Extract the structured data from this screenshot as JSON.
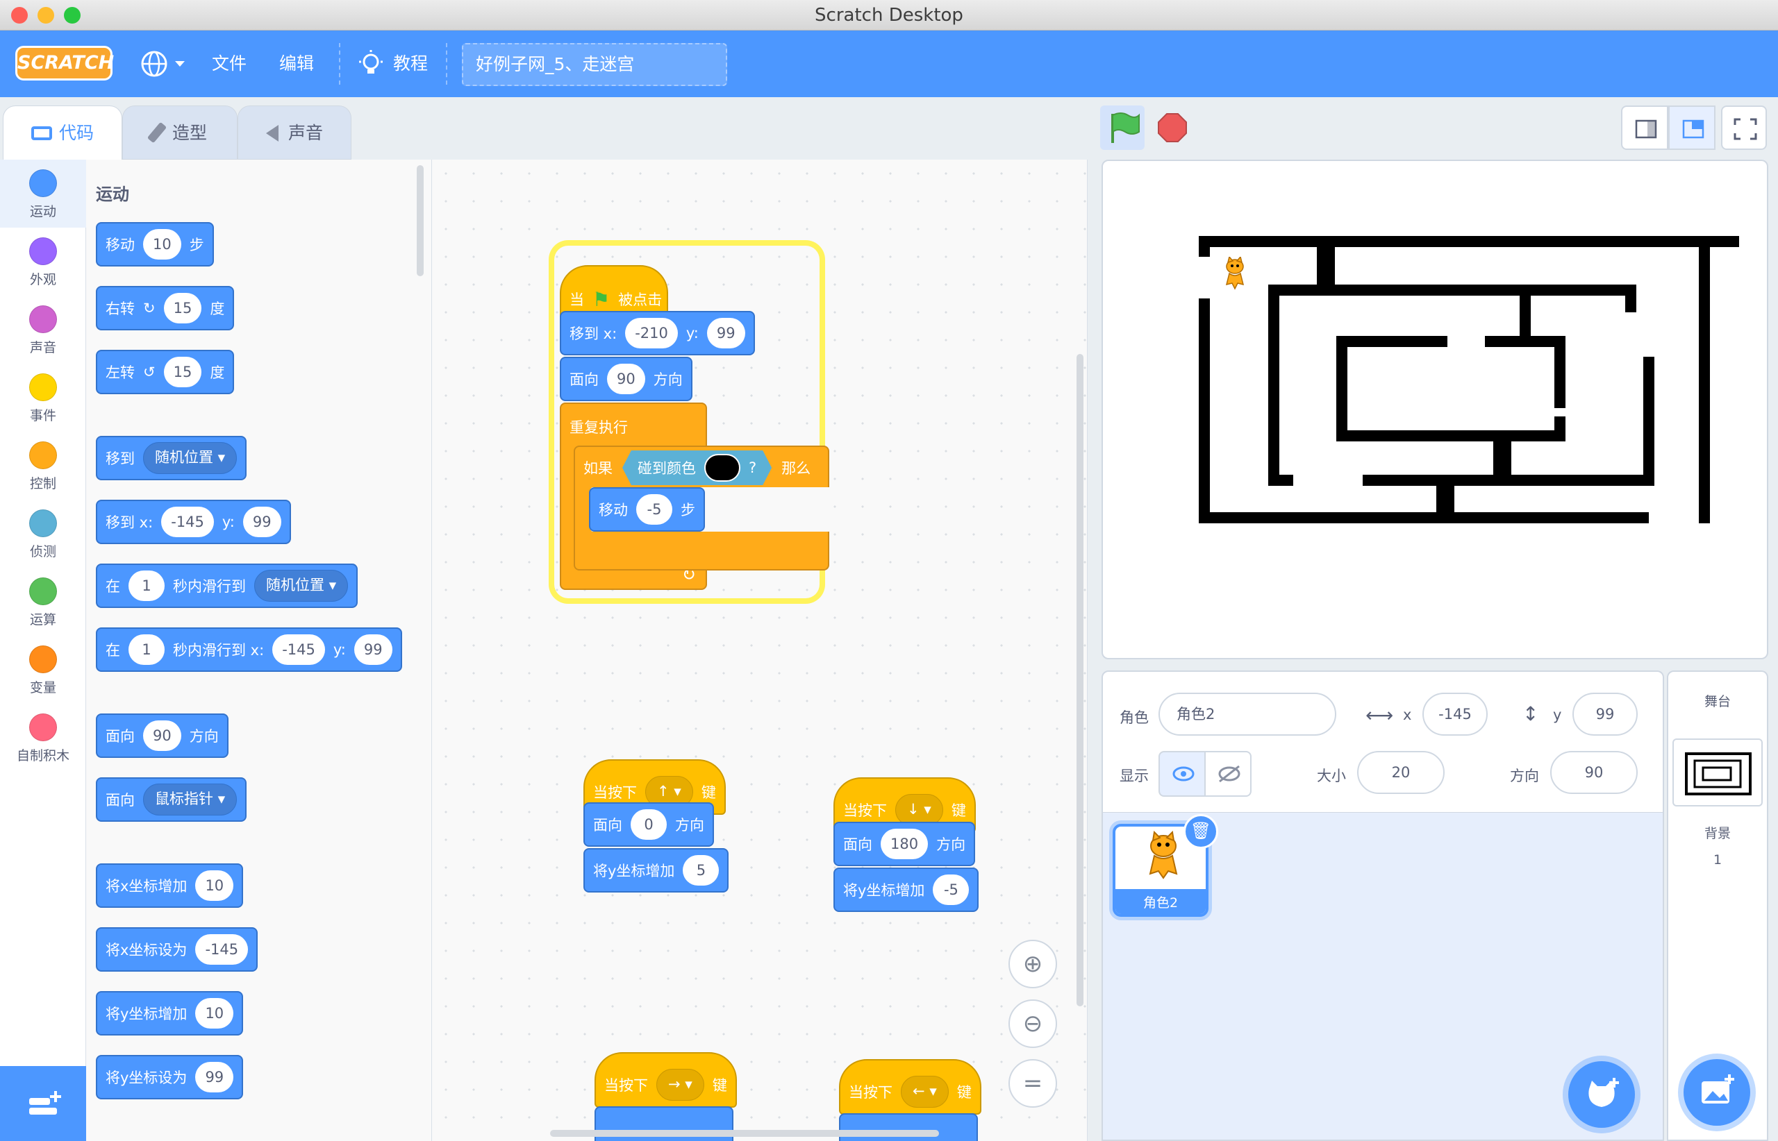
{
  "window": {
    "title": "Scratch Desktop"
  },
  "menubar": {
    "logo": "SCRATCH",
    "file": "文件",
    "edit": "编辑",
    "tutorials": "教程",
    "project_title": "好例子网_5、走迷宫"
  },
  "tabs": {
    "code": "代码",
    "costumes": "造型",
    "sounds": "声音"
  },
  "categories": [
    {
      "label": "运动",
      "color": "#4c97ff"
    },
    {
      "label": "外观",
      "color": "#9966ff"
    },
    {
      "label": "声音",
      "color": "#cf63cf"
    },
    {
      "label": "事件",
      "color": "#ffd500"
    },
    {
      "label": "控制",
      "color": "#ffab19"
    },
    {
      "label": "侦测",
      "color": "#5cb1d6"
    },
    {
      "label": "运算",
      "color": "#59c059"
    },
    {
      "label": "变量",
      "color": "#ff8c1a"
    },
    {
      "label": "自制积木",
      "color": "#ff6680"
    }
  ],
  "palette": {
    "heading": "运动",
    "move": {
      "pre": "移动",
      "val": "10",
      "post": "步"
    },
    "turn_right": {
      "pre": "右转",
      "val": "15",
      "post": "度"
    },
    "turn_left": {
      "pre": "左转",
      "val": "15",
      "post": "度"
    },
    "goto": {
      "pre": "移到",
      "drop": "随机位置"
    },
    "goto_xy": {
      "pre": "移到 x:",
      "x": "-145",
      "y_label": "y:",
      "y": "99"
    },
    "glide": {
      "pre": "在",
      "val": "1",
      "mid": "秒内滑行到",
      "drop": "随机位置"
    },
    "glide_xy": {
      "pre": "在",
      "val": "1",
      "mid": "秒内滑行到 x:",
      "x": "-145",
      "y_label": "y:",
      "y": "99"
    },
    "point_dir": {
      "pre": "面向",
      "val": "90",
      "post": "方向"
    },
    "point_towards": {
      "pre": "面向",
      "drop": "鼠标指针"
    },
    "change_x": {
      "pre": "将x坐标增加",
      "val": "10"
    },
    "set_x": {
      "pre": "将x坐标设为",
      "val": "-145"
    },
    "change_y": {
      "pre": "将y坐标增加",
      "val": "10"
    },
    "set_y": {
      "pre": "将y坐标设为",
      "val": "99"
    }
  },
  "script_main": {
    "hat": {
      "pre": "当",
      "post": "被点击"
    },
    "goto": {
      "pre": "移到 x:",
      "x": "-210",
      "y_label": "y:",
      "y": "99"
    },
    "point": {
      "pre": "面向",
      "val": "90",
      "post": "方向"
    },
    "forever": "重复执行",
    "if": {
      "pre": "如果",
      "cond": "碰到颜色",
      "q": "?",
      "post": "那么"
    },
    "move": {
      "pre": "移动",
      "val": "-5",
      "post": "步"
    }
  },
  "script_up": {
    "hat": "当按下",
    "key": "↑",
    "key_suffix": "键",
    "point": {
      "pre": "面向",
      "val": "0",
      "post": "方向"
    },
    "change": {
      "pre": "将y坐标增加",
      "val": "5"
    }
  },
  "script_down": {
    "hat": "当按下",
    "key": "↓",
    "key_suffix": "键",
    "point": {
      "pre": "面向",
      "val": "180",
      "post": "方向"
    },
    "change": {
      "pre": "将y坐标增加",
      "val": "-5"
    }
  },
  "script_right": {
    "hat": "当按下",
    "key": "→",
    "key_suffix": "键"
  },
  "script_left": {
    "hat": "当按下",
    "key": "←",
    "key_suffix": "键"
  },
  "sprite_info": {
    "sprite_label": "角色",
    "sprite_name": "角色2",
    "x_label": "x",
    "x": "-145",
    "y_label": "y",
    "y": "99",
    "show_label": "显示",
    "size_label": "大小",
    "size": "20",
    "direction_label": "方向",
    "direction": "90"
  },
  "sprite_list": [
    {
      "name": "角色2"
    }
  ],
  "stage_panel": {
    "title": "舞台",
    "backdrop_label": "背景",
    "backdrop_count": "1"
  }
}
